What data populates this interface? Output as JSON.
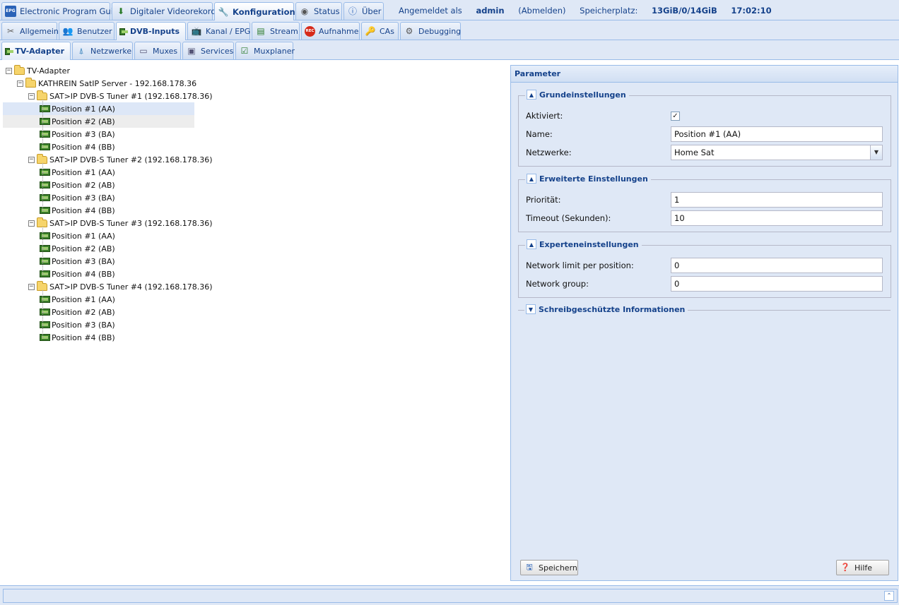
{
  "top_tabs": [
    {
      "label": "Electronic Program Guide",
      "icon": "epg-icon",
      "active": false
    },
    {
      "label": "Digitaler Videorekorder",
      "icon": "download-icon",
      "active": false
    },
    {
      "label": "Konfiguration",
      "icon": "wrench-icon",
      "active": true
    },
    {
      "label": "Status",
      "icon": "eye-icon",
      "active": false
    },
    {
      "label": "Über",
      "icon": "info-icon",
      "active": false
    }
  ],
  "session": {
    "logged_in_prefix": "Angemeldet als",
    "user": "admin",
    "logout": "(Abmelden)",
    "storage_prefix": "Speicherplatz:",
    "storage_value": "13GiB/0/14GiB",
    "time": "17:02:10"
  },
  "config_tabs": [
    {
      "label": "Allgemein",
      "icon": "tools-icon",
      "active": false
    },
    {
      "label": "Benutzer",
      "icon": "users-icon",
      "active": false
    },
    {
      "label": "DVB-Inputs",
      "icon": "tuner-card-icon",
      "active": true
    },
    {
      "label": "Kanal / EPG",
      "icon": "tv-icon",
      "active": false
    },
    {
      "label": "Stream",
      "icon": "stream-icon",
      "active": false
    },
    {
      "label": "Aufnahme",
      "icon": "rec-icon",
      "active": false
    },
    {
      "label": "CAs",
      "icon": "key-icon",
      "active": false
    },
    {
      "label": "Debugging",
      "icon": "gears-icon",
      "active": false
    }
  ],
  "dvb_tabs": [
    {
      "label": "TV-Adapter",
      "icon": "tuner-card-icon",
      "active": true
    },
    {
      "label": "Netzwerke",
      "icon": "antenna-icon",
      "active": false
    },
    {
      "label": "Muxes",
      "icon": "monitors-icon",
      "active": false
    },
    {
      "label": "Services",
      "icon": "service-icon",
      "active": false
    },
    {
      "label": "Muxplaner",
      "icon": "calendar-check-icon",
      "active": false
    }
  ],
  "tree": {
    "root": "TV-Adapter",
    "server": "KATHREIN SatIP Server - 192.168.178.36",
    "tuners": [
      {
        "label": "SAT>IP DVB-S Tuner #1 (192.168.178.36)",
        "positions": [
          "Position #1 (AA)",
          "Position #2 (AB)",
          "Position #3 (BA)",
          "Position #4 (BB)"
        ]
      },
      {
        "label": "SAT>IP DVB-S Tuner #2 (192.168.178.36)",
        "positions": [
          "Position #1 (AA)",
          "Position #2 (AB)",
          "Position #3 (BA)",
          "Position #4 (BB)"
        ]
      },
      {
        "label": "SAT>IP DVB-S Tuner #3 (192.168.178.36)",
        "positions": [
          "Position #1 (AA)",
          "Position #2 (AB)",
          "Position #3 (BA)",
          "Position #4 (BB)"
        ]
      },
      {
        "label": "SAT>IP DVB-S Tuner #4 (192.168.178.36)",
        "positions": [
          "Position #1 (AA)",
          "Position #2 (AB)",
          "Position #3 (BA)",
          "Position #4 (BB)"
        ]
      }
    ]
  },
  "panel": {
    "title": "Parameter",
    "basic": {
      "legend": "Grundeinstellungen",
      "enabled_label": "Aktiviert:",
      "enabled_mark": "✓",
      "name_label": "Name:",
      "name_value": "Position #1 (AA)",
      "networks_label": "Netzwerke:",
      "networks_value": "Home Sat"
    },
    "advanced": {
      "legend": "Erweiterte Einstellungen",
      "priority_label": "Priorität:",
      "priority_value": "1",
      "timeout_label": "Timeout (Sekunden):",
      "timeout_value": "10"
    },
    "expert": {
      "legend": "Experteneinstellungen",
      "limit_label": "Network limit per position:",
      "limit_value": "0",
      "group_label": "Network group:",
      "group_value": "0"
    },
    "readonly": {
      "legend": "Schreibgeschützte Informationen"
    },
    "save_label": "Speichern",
    "help_label": "Hilfe"
  }
}
